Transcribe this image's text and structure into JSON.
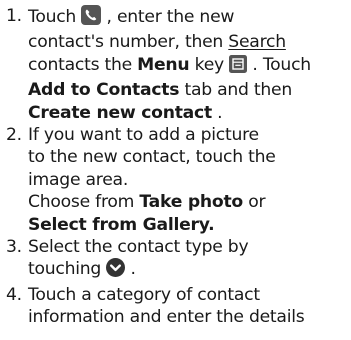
{
  "steps": [
    {
      "num": "1.",
      "lines": [
        {
          "a": "Touch ",
          "icon": "phone-icon",
          "b": ", enter the new"
        },
        {
          "a": "contact's number, then ",
          "link": "Search"
        },
        {
          "a": "contacts the ",
          "bold1": "Menu",
          "b": " key ",
          "icon": "menu-key-icon",
          "c": ". Touch"
        },
        {
          "bold1": "Add to Contacts",
          "b": " tab and then"
        },
        {
          "bold1": "Create new contact",
          "b": "."
        }
      ]
    },
    {
      "num": "2.",
      "lines": [
        {
          "a": "If you want to add a picture"
        },
        {
          "a": "to the new contact, touch the"
        },
        {
          "a": "image area."
        },
        {
          "a": "Choose from ",
          "bold1": "Take photo",
          "b": " or"
        },
        {
          "bold1": "Select from Gallery."
        }
      ]
    },
    {
      "num": "3.",
      "lines": [
        {
          "a": "Select the contact type by"
        },
        {
          "a": "touching ",
          "icon": "chevron-down-circle-icon",
          "b": "."
        }
      ]
    },
    {
      "num": "4.",
      "lines": [
        {
          "a": "Touch a category of contact"
        },
        {
          "a": "information and enter the details"
        }
      ]
    }
  ]
}
